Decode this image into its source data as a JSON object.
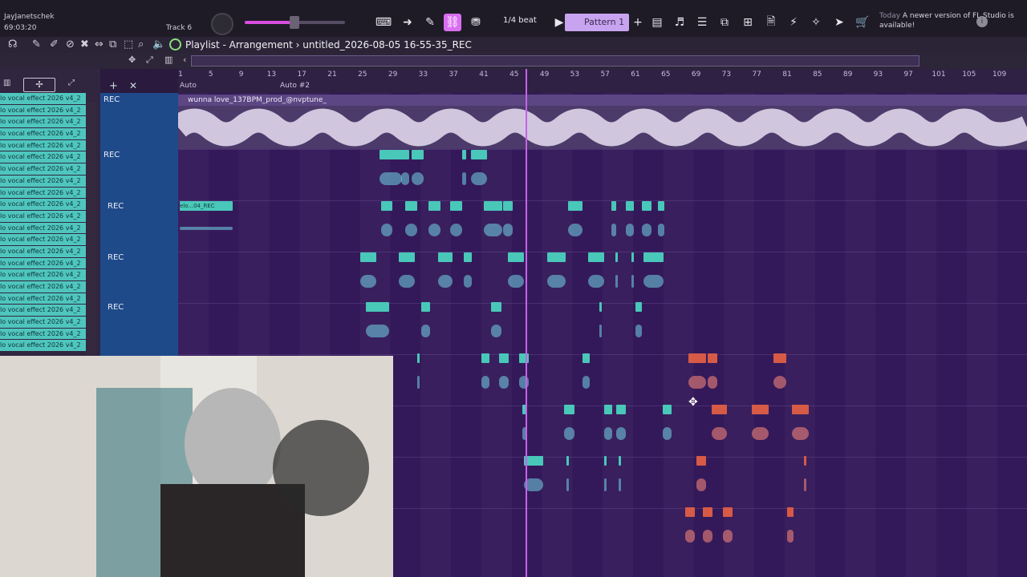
{
  "app": {
    "user": "JayJanetschek",
    "time": "69:03:20",
    "track": "Track 6",
    "playlist": "Playlist - Arrangement",
    "file": "untitled_2026-08-05 16-55-35_REC",
    "beat": "1/4 beat",
    "pattern": "Pattern 1",
    "news": {
      "today": "Today",
      "text": "A newer version of FL Studio is available!"
    }
  },
  "ruler": [
    "1",
    "5",
    "9",
    "13",
    "17",
    "21",
    "25",
    "29",
    "33",
    "37",
    "41",
    "45",
    "49",
    "53",
    "57",
    "61",
    "65",
    "69",
    "73",
    "77",
    "81",
    "85",
    "89",
    "93",
    "97",
    "101",
    "105",
    "109"
  ],
  "auto": [
    "Auto",
    "Auto #2"
  ],
  "tracks": {
    "rec": [
      "REC",
      "REC",
      "REC",
      "REC",
      "REC"
    ],
    "wave_title": "wunna love_137BPM_prod_@nvptune_"
  },
  "list_items": [
    "lo vocal effect 2026 v4_2",
    "lo vocal effect 2026 v4_2",
    "lo vocal effect 2026 v4_2",
    "lo vocal effect 2026 v4_2",
    "lo vocal effect 2026 v4_2",
    "lo vocal effect 2026 v4_2",
    "lo vocal effect 2026 v4_2",
    "lo vocal effect 2026 v4_2",
    "lo vocal effect 2026 v4_2",
    "lo vocal effect 2026 v4_2",
    "lo vocal effect 2026 v4_2",
    "lo vocal effect 2026 v4_2",
    "lo vocal effect 2026 v4_2",
    "lo vocal effect 2026 v4_2",
    "lo vocal effect 2026 v4_2",
    "lo vocal effect 2026 v4_2",
    "lo vocal effect 2026 v4_2",
    "lo vocal effect 2026 v4_2",
    "lo vocal effect 2026 v4_2",
    "lo vocal effect 2026 v4_2",
    "lo vocal effect 2026 v4_2",
    "lo vocal effect 2026 v4_2"
  ],
  "clips": {
    "small": "elo...04_REC"
  }
}
